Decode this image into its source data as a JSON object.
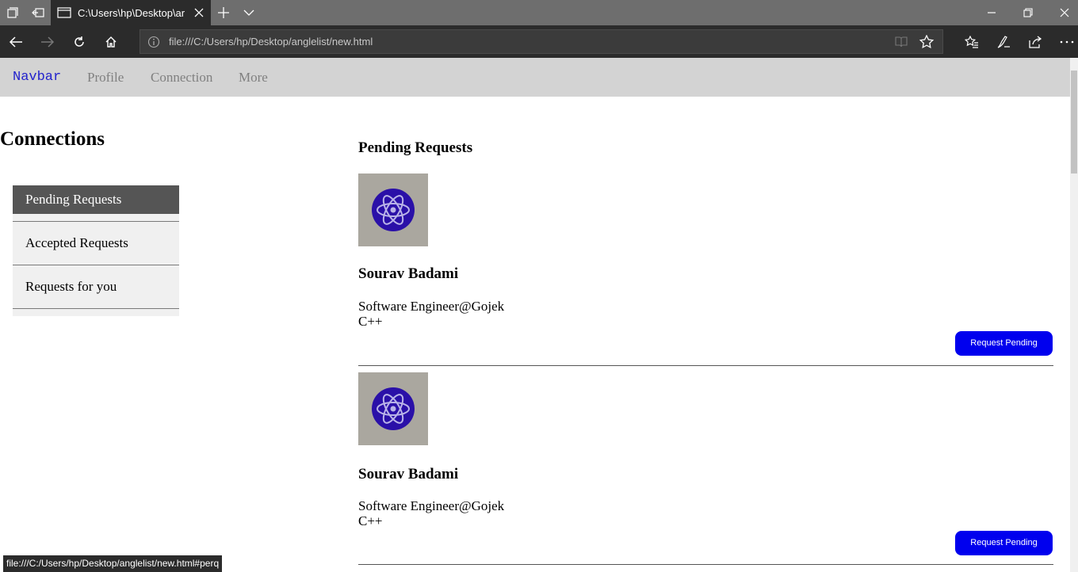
{
  "browser": {
    "tab_title": "C:\\Users\\hp\\Desktop\\ar",
    "url": "file:///C:/Users/hp/Desktop/anglelist/new.html",
    "status_url": "file:///C:/Users/hp/Desktop/anglelist/new.html#perq"
  },
  "navbar": {
    "brand": "Navbar",
    "links": [
      "Profile",
      "Connection",
      "More"
    ]
  },
  "page": {
    "title": "Connections"
  },
  "sidebar": {
    "items": [
      {
        "label": "Pending Requests",
        "active": true
      },
      {
        "label": "Accepted Requests",
        "active": false
      },
      {
        "label": "Requests for you",
        "active": false
      }
    ]
  },
  "main": {
    "section_title": "Pending Requests",
    "cards": [
      {
        "name": "Sourav Badami",
        "role": "Software Engineer@Gojek",
        "skill": "C++",
        "button_label": "Request Pending",
        "avatar_icon": "react-atom-icon"
      },
      {
        "name": "Sourav Badami",
        "role": "Software Engineer@Gojek",
        "skill": "C++",
        "button_label": "Request Pending",
        "avatar_icon": "react-atom-icon"
      }
    ]
  },
  "colors": {
    "brand": "#2222cc",
    "button": "#0000ee",
    "navbar_bg": "#d3d3d3",
    "sidebar_active_bg": "#555555"
  }
}
